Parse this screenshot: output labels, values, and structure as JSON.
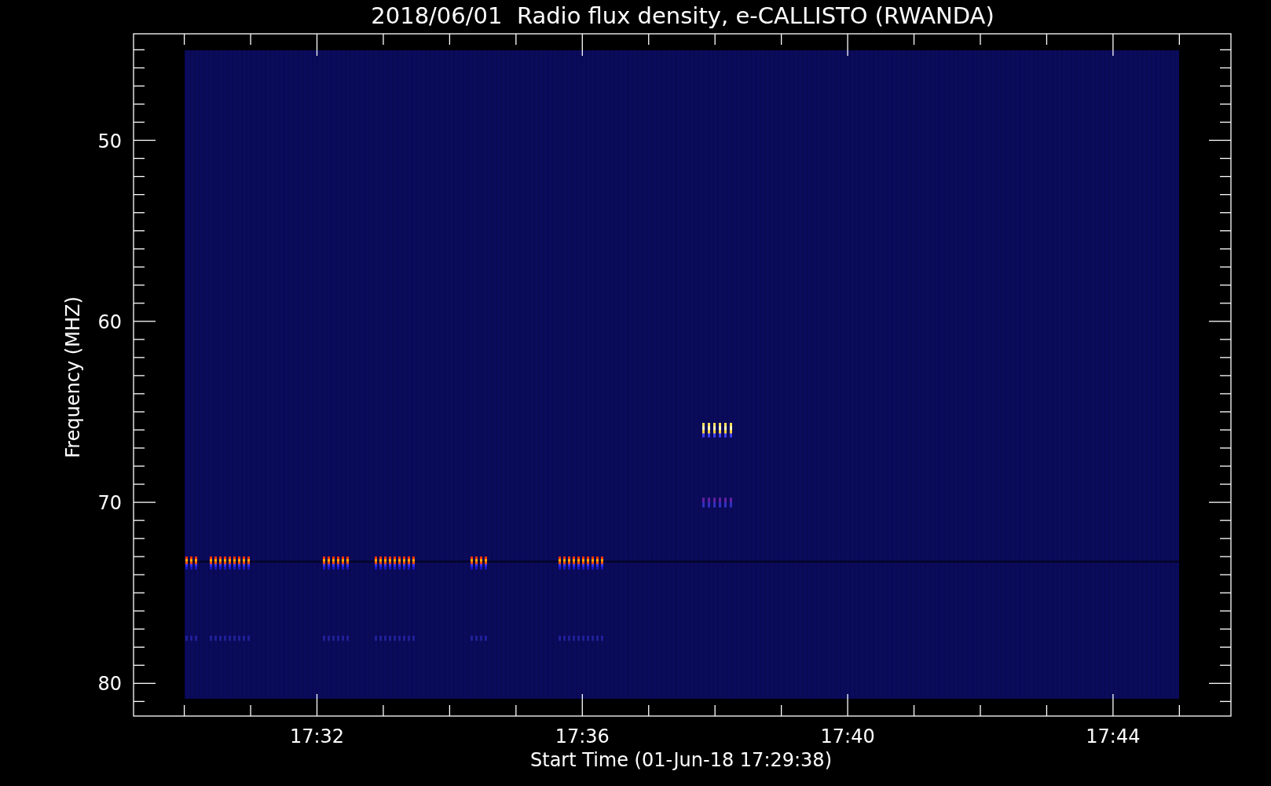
{
  "chart": {
    "title": "2018/06/01  Radio flux density, e-CALLISTO (RWANDA)",
    "y_axis": {
      "label": "Frequency (MHZ)",
      "ticks": [
        "50",
        "60",
        "70",
        "80"
      ]
    },
    "x_axis": {
      "label": "Start Time (01-Jun-18 17:29:38)",
      "ticks": [
        "17:32",
        "17:36",
        "17:40",
        "17:44"
      ]
    }
  }
}
